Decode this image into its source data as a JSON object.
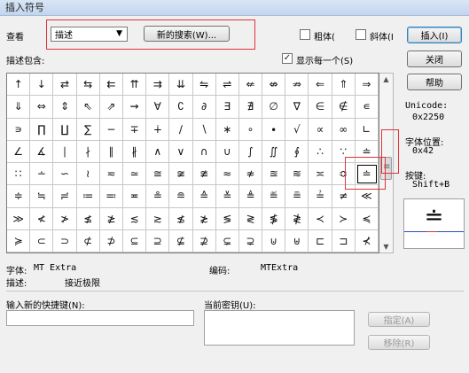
{
  "window": {
    "title": "插入符号"
  },
  "view": {
    "label": "查看",
    "dropdown_value": "描述",
    "new_search_label": "新的搜索(W)...",
    "bold_label": "粗体(",
    "italic_label": "斜体(I",
    "bold_checked": false,
    "italic_checked": false
  },
  "desc": {
    "label": "描述包含:"
  },
  "show_each": {
    "label": "显示每一个(S)",
    "checked": true
  },
  "buttons": {
    "insert": "插入(I)",
    "close": "关闭",
    "help": "帮助",
    "assign": "指定(A)",
    "remove": "移除(R)"
  },
  "info": {
    "unicode_label": "Unicode:",
    "unicode_value": "0x2250",
    "font_pos_label": "字体位置:",
    "font_pos_value": "0x42",
    "key_label": "按键:",
    "key_value": "Shift+B"
  },
  "grid": {
    "rows": [
      [
        "↑",
        "↓",
        "⇄",
        "⇆",
        "⇇",
        "⇈",
        "⇉",
        "⇊",
        "⇋",
        "⇌",
        "⇍",
        "⇎",
        "⇏",
        "⇐",
        "⇑",
        "⇒"
      ],
      [
        "⇓",
        "⇔",
        "⇕",
        "⇖",
        "⇗",
        "⇝",
        "∀",
        "∁",
        "∂",
        "∃",
        "∄",
        "∅",
        "∇",
        "∈",
        "∉",
        "∊"
      ],
      [
        "∍",
        "∏",
        "∐",
        "∑",
        "−",
        "∓",
        "∔",
        "∕",
        "∖",
        "∗",
        "∘",
        "∙",
        "√",
        "∝",
        "∞",
        "∟"
      ],
      [
        "∠",
        "∡",
        "∣",
        "∤",
        "∥",
        "∦",
        "∧",
        "∨",
        "∩",
        "∪",
        "∫",
        "∬",
        "∮",
        "∴",
        "∵",
        "≐"
      ],
      [
        "∷",
        "∸",
        "∽",
        "≀",
        "≂",
        "≃",
        "≅",
        "≆",
        "≇",
        "≈",
        "≉",
        "≊",
        "≋",
        "≍",
        "≎",
        "≐"
      ],
      [
        "≑",
        "≒",
        "≓",
        "≔",
        "≕",
        "≖",
        "≗",
        "≘",
        "≙",
        "≚",
        "≜",
        "≝",
        "≞",
        "≟",
        "≠",
        "≪"
      ],
      [
        "≫",
        "≮",
        "≯",
        "≰",
        "≱",
        "≲",
        "≳",
        "≴",
        "≵",
        "≶",
        "≷",
        "≸",
        "≹",
        "≺",
        "≻",
        "≼"
      ],
      [
        "≽",
        "⊂",
        "⊃",
        "⊄",
        "⊅",
        "⊆",
        "⊇",
        "⊈",
        "⊉",
        "⊊",
        "⊋",
        "⊍",
        "⊎",
        "⊏",
        "⊐",
        "⊀"
      ]
    ],
    "selected_row": 4,
    "selected_col": 15
  },
  "font_info": {
    "font_label": "字体:",
    "font_value": "MT Extra",
    "code_label": "编码:",
    "code_value": "MTExtra",
    "description_label": "描述:",
    "description_value": "接近极限"
  },
  "shortcut": {
    "new_label": "输入新的快捷键(N):",
    "current_label": "当前密钥(U):"
  },
  "preview": {
    "symbol": "≐"
  }
}
